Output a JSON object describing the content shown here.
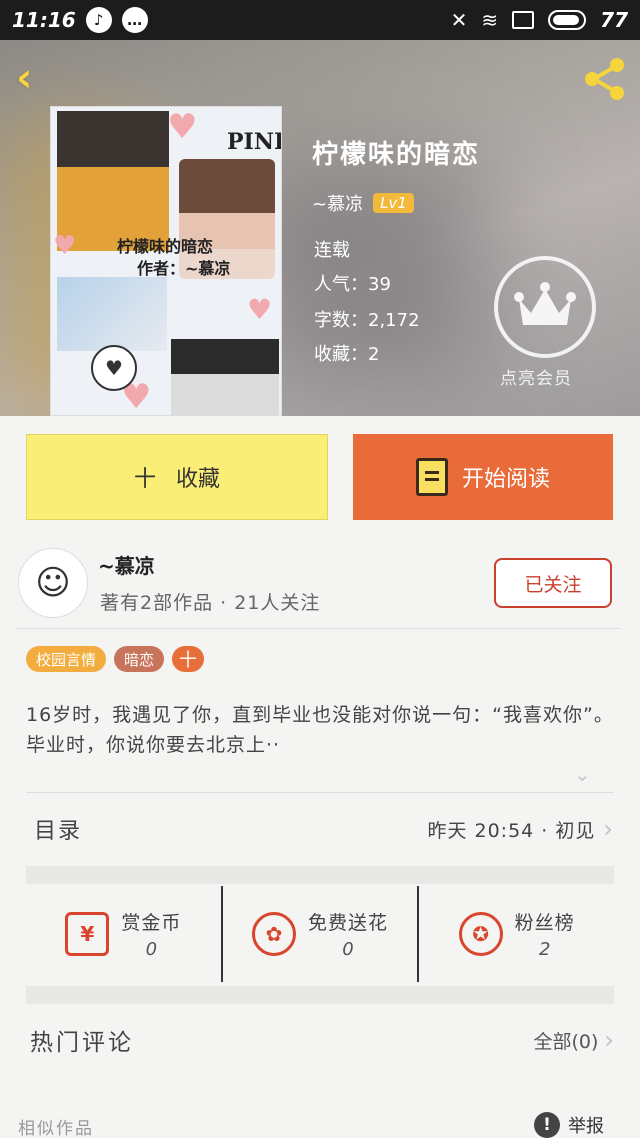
{
  "status_bar": {
    "time": "11:16",
    "battery": "77"
  },
  "book": {
    "title": "柠檬味的暗恋",
    "cover_title": "柠檬味的暗恋",
    "cover_author": "作者：~慕凉",
    "cover_word": "PINK",
    "author": "~慕凉",
    "level": "Lv1",
    "status": "连载",
    "popularity": "人气：39",
    "word_count": "字数：2,172",
    "favorites": "收藏：2",
    "vip_label": "点亮会员"
  },
  "actions": {
    "favorite_icon": "十",
    "favorite_label": "收藏",
    "read_label": "开始阅读"
  },
  "author_card": {
    "name": "~慕凉",
    "stats": "著有2部作品 · 21人关注",
    "follow_label": "已关注"
  },
  "tags": [
    "校园言情",
    "暗恋",
    "十"
  ],
  "synopsis": "16岁时，我遇见了你，直到毕业也没能对你说一句：“我喜欢你”。毕业时，你说你要去北京上··",
  "toc": {
    "title": "目录",
    "info": "昨天 20:54 · 初见"
  },
  "stats": [
    {
      "label": "赏金币",
      "value": "0",
      "icon": "red-envelope-icon"
    },
    {
      "label": "免费送花",
      "value": "0",
      "icon": "flower-icon"
    },
    {
      "label": "粉丝榜",
      "value": "2",
      "icon": "medal-icon"
    }
  ],
  "comments": {
    "title": "热门评论",
    "all_label": "全部(0)"
  },
  "footer": {
    "similar": "相似作品",
    "report": "举报"
  },
  "colors": {
    "accent_orange": "#ea6b3a",
    "favorite_yellow": "#fbee76",
    "follow_red": "#c9402c",
    "back_yellow": "#f5d43c"
  }
}
